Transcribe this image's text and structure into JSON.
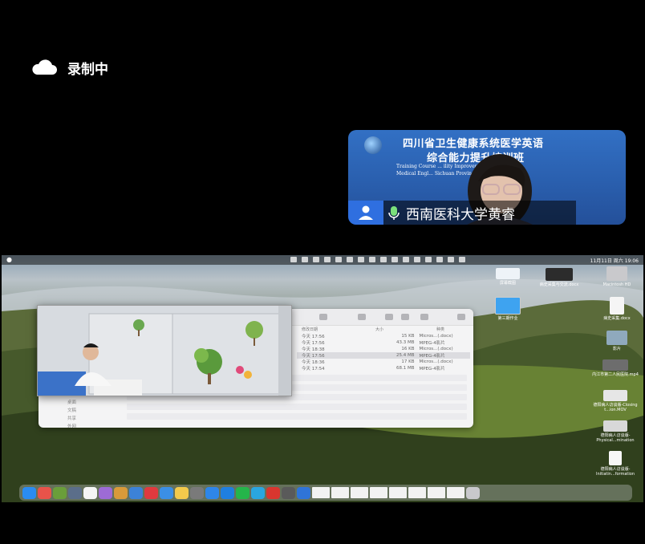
{
  "recording": {
    "status_label": "录制中",
    "icon": "cloud-icon"
  },
  "video_tile": {
    "banner_title_line1": "四川省卫生健康系统医学英语",
    "banner_title_line2": "综合能力提升培训班",
    "banner_en_line1": "Training Course ... ility Improvement of",
    "banner_en_line2": "Medical Engl...               Sichuan Province",
    "participant_name": "西南医科大学黄睿",
    "user_icon": "user-icon",
    "mic_icon": "microphone-icon",
    "accent_color": "#2f6fe0"
  },
  "desktop": {
    "menubar": {
      "apple_icon": "apple-icon",
      "clock": "11月11日 周六 19:06"
    },
    "finder": {
      "columns": [
        "修改日期",
        "大小",
        "种类"
      ],
      "rows": [
        {
          "date": "今天 17:56",
          "size": "15 KB",
          "kind": "Micros...(.docx)",
          "selected": false
        },
        {
          "date": "今天 17:56",
          "size": "43.3 MB",
          "kind": "MPEG-4影片",
          "selected": false
        },
        {
          "date": "今天 18:38",
          "size": "16 KB",
          "kind": "Micros...(.docx)",
          "selected": false
        },
        {
          "date": "今天 17:56",
          "size": "25.4 MB",
          "kind": "MPEG-4影片",
          "selected": true
        },
        {
          "date": "今天 18:36",
          "size": "17 KB",
          "kind": "Micros...(.docx)",
          "selected": false
        },
        {
          "date": "今天 17:54",
          "size": "68.1 MB",
          "kind": "MPEG-4影片",
          "selected": false
        }
      ],
      "sidebar": [
        "桌面",
        "文稿",
        "共享",
        "外网"
      ]
    },
    "icons": [
      {
        "label": "屏幕截图",
        "kind": "image"
      },
      {
        "label": "病史采集与交流.docx",
        "kind": "image"
      },
      {
        "label": "Macintosh HD",
        "kind": "disk"
      },
      {
        "label": "第三期作业",
        "kind": "folder"
      },
      {
        "label": "病史采集.docx",
        "kind": "doc"
      },
      {
        "label": "影片",
        "kind": "folder"
      },
      {
        "label": "内江市第二人民医院.mp4",
        "kind": "video"
      },
      {
        "label": "德阳病人访谈版-Closing t...ion.MOV",
        "kind": "video"
      },
      {
        "label": "德阳病人访谈版-Physical...mination",
        "kind": "video"
      },
      {
        "label": "德阳病人访谈版-Initiatin...formation",
        "kind": "doc"
      }
    ],
    "dock_colors": [
      "#2a8cf2",
      "#e8534a",
      "#6a9e3a",
      "#5b6e8a",
      "#f5f5f5",
      "#9d6bd6",
      "#d89a3a",
      "#3c82d8",
      "#e0393e",
      "#3b8fe6",
      "#f2c94c",
      "#7a7a7a",
      "#2e86e8",
      "#1f7fe0",
      "#25b54a",
      "#2aa6e0",
      "#d9362f",
      "#5a5a5a",
      "#2f74d8"
    ]
  }
}
